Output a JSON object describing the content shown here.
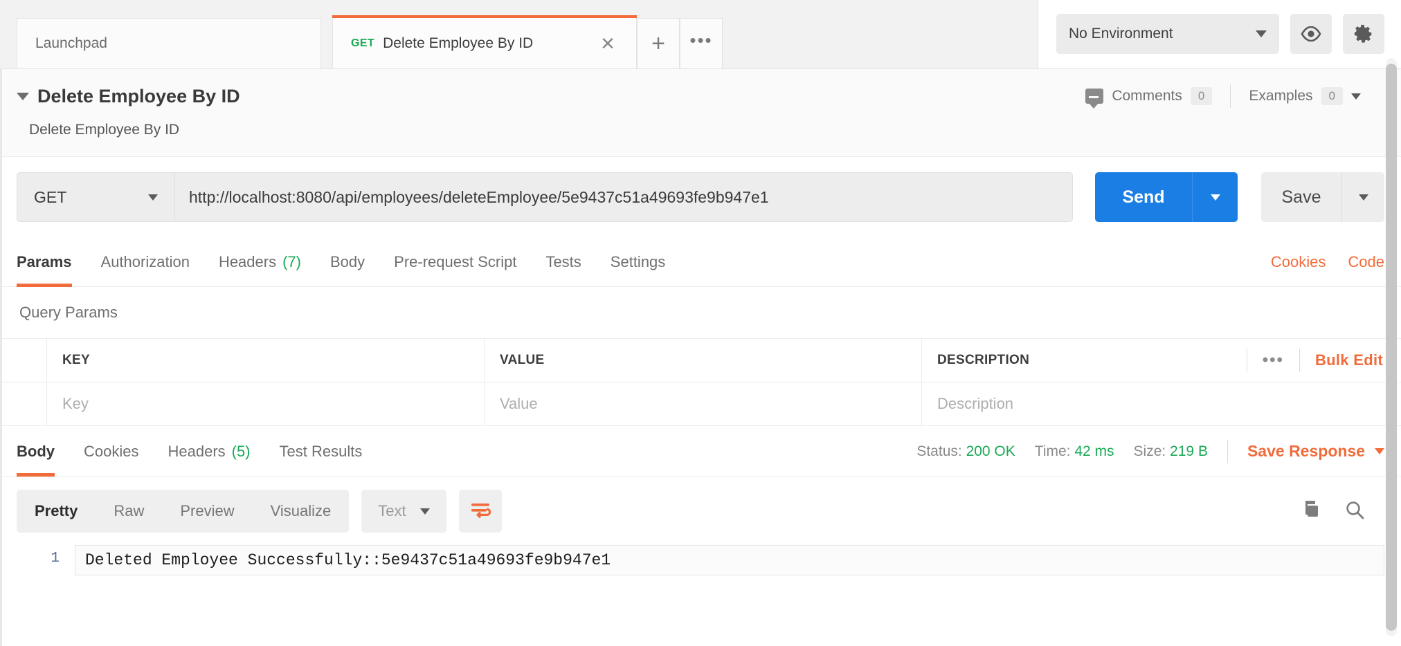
{
  "tabs": {
    "launchpad": {
      "label": "Launchpad"
    },
    "request": {
      "method": "GET",
      "label": "Delete Employee By ID",
      "close": "✕"
    },
    "new_tab": "+",
    "more": "•••"
  },
  "environment": {
    "selected": "No Environment",
    "eye_icon": "eye-icon",
    "gear_icon": "gear-icon"
  },
  "request_header": {
    "title": "Delete Employee By ID",
    "description": "Delete Employee By ID",
    "comments_label": "Comments",
    "comments_count": "0",
    "examples_label": "Examples",
    "examples_count": "0"
  },
  "url_bar": {
    "method": "GET",
    "url": "http://localhost:8080/api/employees/deleteEmployee/5e9437c51a49693fe9b947e1",
    "send_label": "Send",
    "save_label": "Save"
  },
  "request_tabs": [
    {
      "label": "Params",
      "count": "",
      "active": true
    },
    {
      "label": "Authorization",
      "count": "",
      "active": false
    },
    {
      "label": "Headers",
      "count": "(7)",
      "active": false
    },
    {
      "label": "Body",
      "count": "",
      "active": false
    },
    {
      "label": "Pre-request Script",
      "count": "",
      "active": false
    },
    {
      "label": "Tests",
      "count": "",
      "active": false
    },
    {
      "label": "Settings",
      "count": "",
      "active": false
    }
  ],
  "request_tabs_right": {
    "cookies": "Cookies",
    "code": "Code"
  },
  "query_params": {
    "section_title": "Query Params",
    "columns": {
      "key": "KEY",
      "value": "VALUE",
      "description": "DESCRIPTION"
    },
    "actions": {
      "dots": "•••",
      "bulk_edit": "Bulk Edit"
    },
    "rows": [
      {
        "key_placeholder": "Key",
        "value_placeholder": "Value",
        "description_placeholder": "Description"
      }
    ]
  },
  "response_tabs": [
    {
      "label": "Body",
      "count": "",
      "active": true
    },
    {
      "label": "Cookies",
      "count": "",
      "active": false
    },
    {
      "label": "Headers",
      "count": "(5)",
      "active": false
    },
    {
      "label": "Test Results",
      "count": "",
      "active": false
    }
  ],
  "response_meta": {
    "status_label": "Status:",
    "status_value": "200 OK",
    "time_label": "Time:",
    "time_value": "42 ms",
    "size_label": "Size:",
    "size_value": "219 B",
    "save_response": "Save Response"
  },
  "body_toolbar": {
    "views": [
      {
        "label": "Pretty",
        "active": true
      },
      {
        "label": "Raw",
        "active": false
      },
      {
        "label": "Preview",
        "active": false
      },
      {
        "label": "Visualize",
        "active": false
      }
    ],
    "format": "Text",
    "wrap_icon": "word-wrap-icon",
    "copy_icon": "copy-icon",
    "search_icon": "search-icon"
  },
  "response_body": {
    "lines": [
      {
        "number": "1",
        "text": "Deleted Employee Successfully::5e9437c51a49693fe9b947e1"
      }
    ]
  },
  "colors": {
    "accent_orange": "#f26b3a",
    "send_blue": "#1a7ee5",
    "success_green": "#1aaa55"
  }
}
